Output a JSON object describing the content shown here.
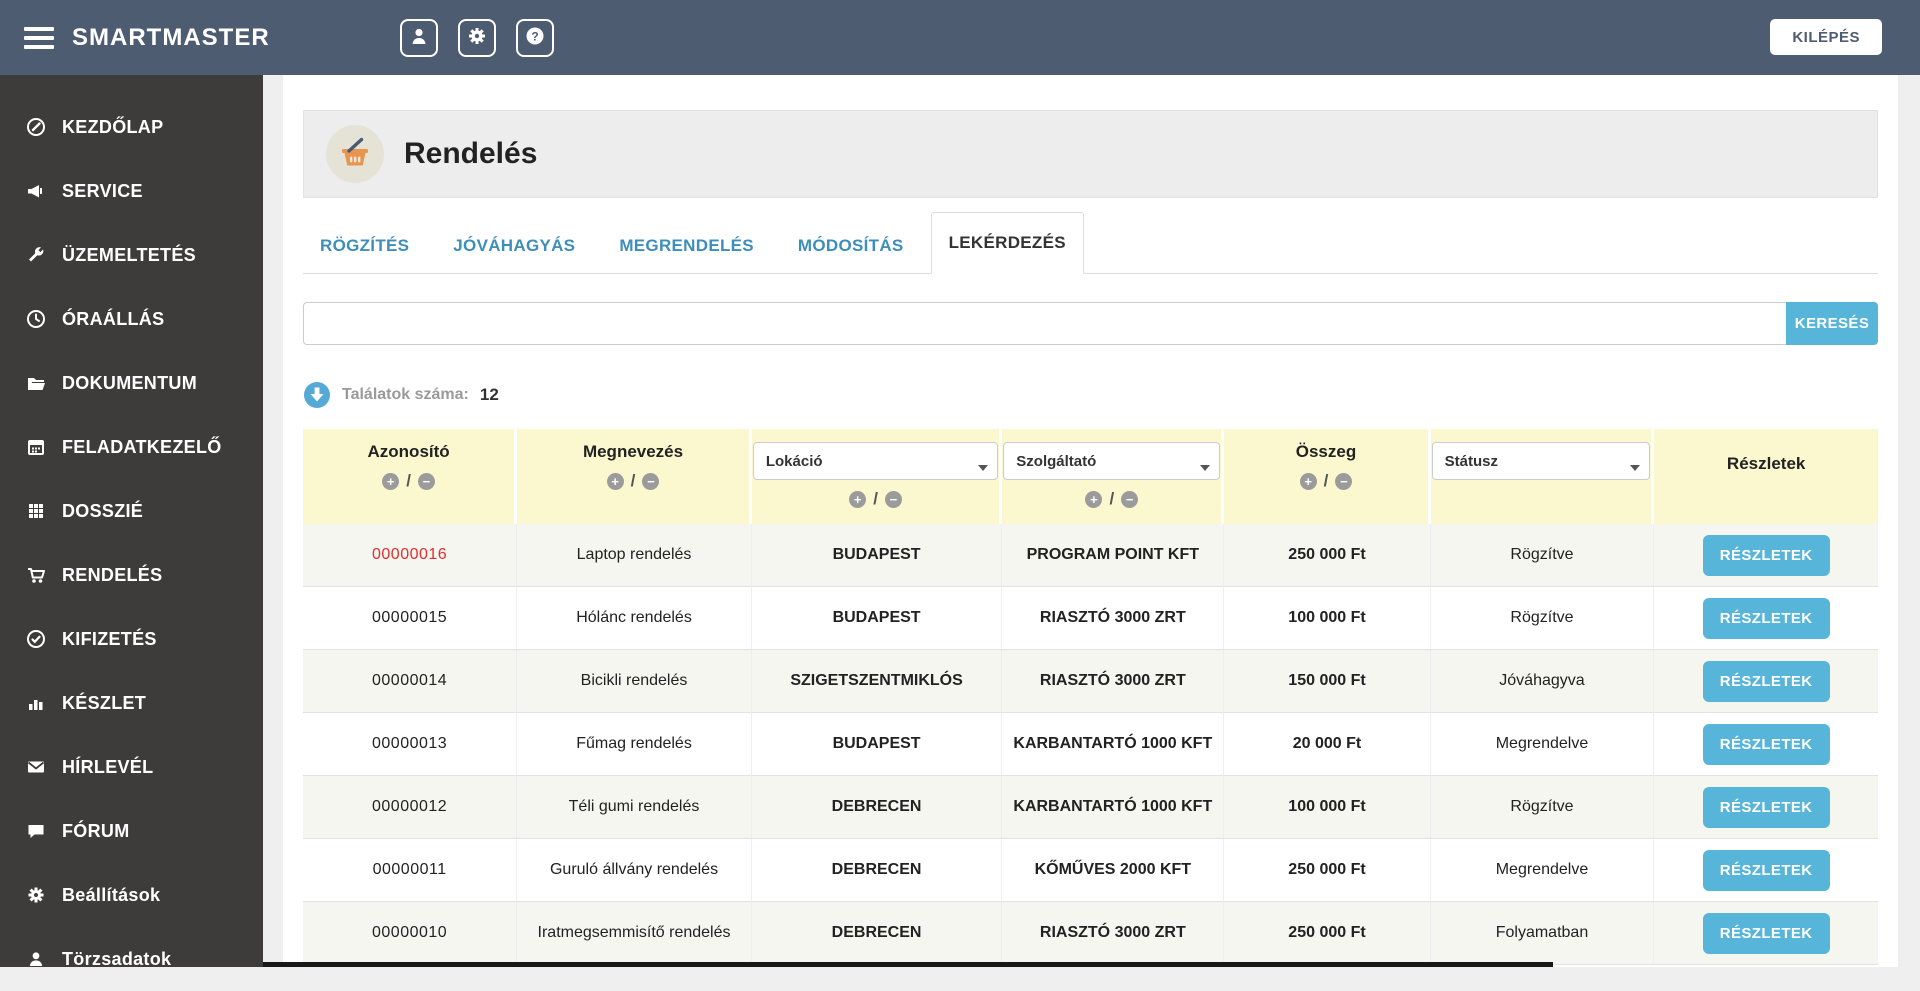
{
  "colors": {
    "topbar": "#4e5c72",
    "sidebar": "#3e3b3b",
    "accent_blue": "#56b5d8",
    "tab_blue": "#3d8eba",
    "id_red": "#e12e2e",
    "table_header_yellow": "#fbf8d0"
  },
  "topbar": {
    "brand": "SMARTMASTER",
    "logout_label": "KILÉPÉS",
    "icons": [
      "user-icon",
      "gear-icon",
      "help-icon"
    ]
  },
  "sidebar": {
    "items": [
      {
        "label": "KEZDŐLAP",
        "icon": "edit-icon"
      },
      {
        "label": "SERVICE",
        "icon": "megaphone-icon"
      },
      {
        "label": "ÜZEMELTETÉS",
        "icon": "wrench-icon"
      },
      {
        "label": "ÓRAÁLLÁS",
        "icon": "clock-icon"
      },
      {
        "label": "DOKUMENTUM",
        "icon": "folder-icon"
      },
      {
        "label": "FELADATKEZELŐ",
        "icon": "calendar-icon"
      },
      {
        "label": "DOSSZIÉ",
        "icon": "grid-icon"
      },
      {
        "label": "RENDELÉS",
        "icon": "cart-icon"
      },
      {
        "label": "KIFIZETÉS",
        "icon": "check-circle-icon"
      },
      {
        "label": "KÉSZLET",
        "icon": "bar-chart-icon"
      },
      {
        "label": "HÍRLEVÉL",
        "icon": "envelope-icon"
      },
      {
        "label": "FÓRUM",
        "icon": "comment-icon"
      },
      {
        "label": "Beállítások",
        "icon": "gear-icon"
      },
      {
        "label": "Törzsadatok",
        "icon": "user-icon"
      }
    ]
  },
  "page": {
    "title": "Rendelés",
    "tabs": [
      {
        "label": "RÖGZÍTÉS",
        "active": false
      },
      {
        "label": "JÓVÁHAGYÁS",
        "active": false
      },
      {
        "label": "MEGRENDELÉS",
        "active": false
      },
      {
        "label": "MÓDOSÍTÁS",
        "active": false
      },
      {
        "label": "LEKÉRDEZÉS",
        "active": true
      }
    ],
    "search": {
      "value": "",
      "button_label": "KERESÉS"
    },
    "results": {
      "label": "Találatok száma:",
      "count": "12"
    }
  },
  "table": {
    "columns": [
      {
        "label": "Azonosító",
        "type": "sort"
      },
      {
        "label": "Megnevezés",
        "type": "sort"
      },
      {
        "label": "Lokáció",
        "type": "filter-sort"
      },
      {
        "label": "Szolgáltató",
        "type": "filter-sort"
      },
      {
        "label": "Összeg",
        "type": "sort"
      },
      {
        "label": "Státusz",
        "type": "filter"
      },
      {
        "label": "Részletek",
        "type": "plain"
      }
    ],
    "sort_plus": "+",
    "sort_minus": "−",
    "sort_slash": "/",
    "details_label": "RÉSZLETEK",
    "rows": [
      {
        "id": "00000016",
        "id_red": true,
        "name": "Laptop rendelés",
        "location": "BUDAPEST",
        "provider": "PROGRAM POINT KFT",
        "amount": "250 000 Ft",
        "status": "Rögzítve"
      },
      {
        "id": "00000015",
        "id_red": false,
        "name": "Hólánc rendelés",
        "location": "BUDAPEST",
        "provider": "RIASZTÓ 3000 ZRT",
        "amount": "100 000 Ft",
        "status": "Rögzítve"
      },
      {
        "id": "00000014",
        "id_red": false,
        "name": "Bicikli rendelés",
        "location": "SZIGETSZENTMIKLÓS",
        "provider": "RIASZTÓ 3000 ZRT",
        "amount": "150 000 Ft",
        "status": "Jóváhagyva"
      },
      {
        "id": "00000013",
        "id_red": false,
        "name": "Fűmag rendelés",
        "location": "BUDAPEST",
        "provider": "KARBANTARTÓ 1000 KFT",
        "amount": "20 000 Ft",
        "status": "Megrendelve"
      },
      {
        "id": "00000012",
        "id_red": false,
        "name": "Téli gumi rendelés",
        "location": "DEBRECEN",
        "provider": "KARBANTARTÓ 1000 KFT",
        "amount": "100 000 Ft",
        "status": "Rögzítve"
      },
      {
        "id": "00000011",
        "id_red": false,
        "name": "Guruló állvány rendelés",
        "location": "DEBRECEN",
        "provider": "KŐMŰVES 2000 KFT",
        "amount": "250 000 Ft",
        "status": "Megrendelve"
      },
      {
        "id": "00000010",
        "id_red": false,
        "name": "Iratmegsemmisítő rendelés",
        "location": "DEBRECEN",
        "provider": "RIASZTÓ 3000 ZRT",
        "amount": "250 000 Ft",
        "status": "Folyamatban"
      }
    ]
  }
}
